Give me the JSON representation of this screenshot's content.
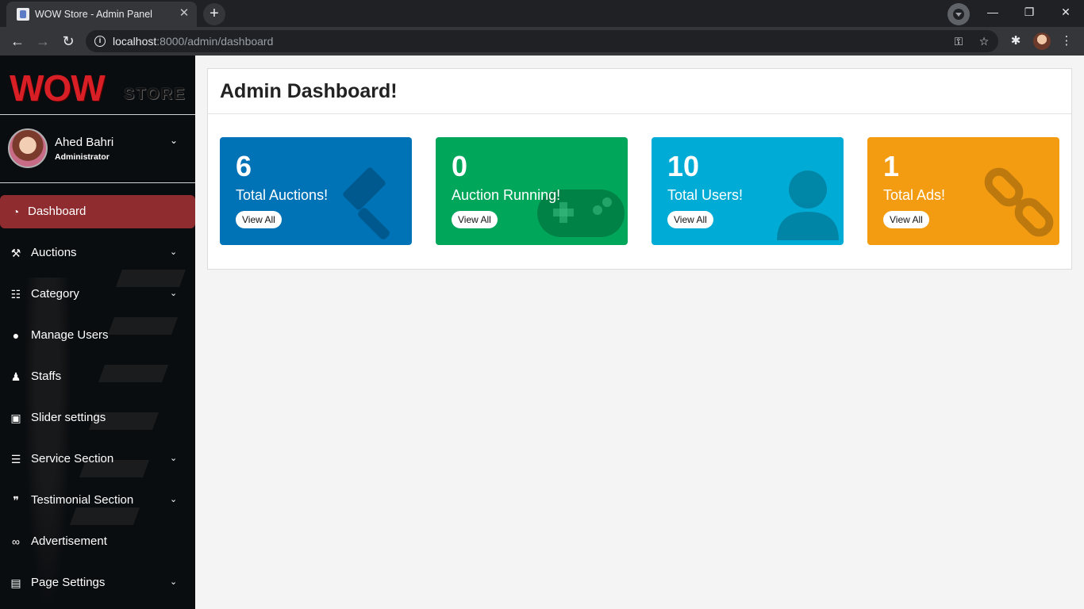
{
  "browser": {
    "tab_title": "WOW Store - Admin Panel",
    "url_host": "localhost",
    "url_rest": ":8000/admin/dashboard",
    "new_tab": "+",
    "minimize": "—",
    "restore": "❐",
    "close": "✕",
    "tab_close": "✕"
  },
  "sidebar": {
    "logo_main": "WOW",
    "logo_sub": "STORE",
    "user_name": "Ahed Bahri",
    "user_role": "Administrator",
    "items": [
      {
        "label": "Dashboard",
        "icon": "tachometer-icon",
        "glyph": "◔",
        "caret": false
      },
      {
        "label": "Auctions",
        "icon": "gavel-icon",
        "glyph": "⚒",
        "caret": true
      },
      {
        "label": "Category",
        "icon": "sitemap-icon",
        "glyph": "☷",
        "caret": true
      },
      {
        "label": "Manage Users",
        "icon": "user-icon",
        "glyph": "●",
        "caret": false
      },
      {
        "label": "Staffs",
        "icon": "user-secret-icon",
        "glyph": "♟",
        "caret": false
      },
      {
        "label": "Slider settings",
        "icon": "image-icon",
        "glyph": "▣",
        "caret": false
      },
      {
        "label": "Service Section",
        "icon": "list-icon",
        "glyph": "☰",
        "caret": true
      },
      {
        "label": "Testimonial Section",
        "icon": "quote-icon",
        "glyph": "❞",
        "caret": true
      },
      {
        "label": "Advertisement",
        "icon": "link-icon",
        "glyph": "∞",
        "caret": false
      },
      {
        "label": "Page Settings",
        "icon": "file-code-icon",
        "glyph": "▤",
        "caret": true
      }
    ],
    "active_index": 0
  },
  "main": {
    "title": "Admin Dashboard!",
    "stats": [
      {
        "value": "6",
        "label": "Total Auctions!",
        "button": "View All",
        "color": "#0073b7",
        "icon": "gavel-icon"
      },
      {
        "value": "0",
        "label": "Auction Running!",
        "button": "View All",
        "color": "#00a65a",
        "icon": "gamepad-icon"
      },
      {
        "value": "10",
        "label": "Total Users!",
        "button": "View All",
        "color": "#00acd6",
        "icon": "user-icon"
      },
      {
        "value": "1",
        "label": "Total Ads!",
        "button": "View All",
        "color": "#f39c12",
        "icon": "link-icon"
      }
    ]
  }
}
